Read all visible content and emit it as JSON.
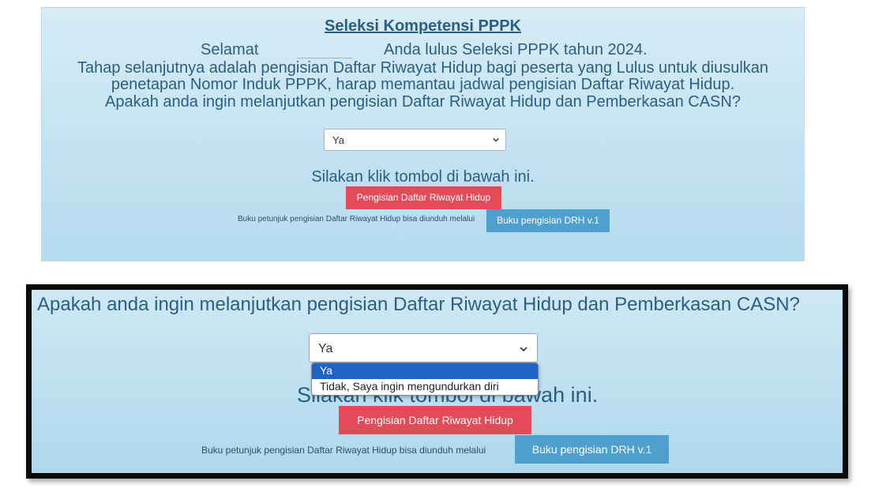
{
  "top": {
    "title": "Seleksi Kompetensi PPPK",
    "greeting": "Selamat",
    "passed_text": "Anda lulus Seleksi PPPK tahun 2024.",
    "line2": "Tahap selanjutnya adalah pengisian Daftar Riwayat Hidup bagi peserta yang Lulus untuk diusulkan",
    "line3": "penetapan Nomor Induk PPPK, harap memantau jadwal pengisian Daftar Riwayat Hidup.",
    "question": "Apakah anda ingin melanjutkan pengisian Daftar Riwayat Hidup dan Pemberkasan CASN?",
    "select_value": "Ya",
    "instruction": "Silakan klik tombol di bawah ini.",
    "drh_button": "Pengisian Daftar Riwayat Hidup",
    "guide_text": "Buku petunjuk pengisian Daftar Riwayat Hidup bisa diunduh melalui",
    "guide_button": "Buku pengisian DRH v.1"
  },
  "zoom": {
    "question": "Apakah anda ingin melanjutkan pengisian Daftar Riwayat Hidup dan Pemberkasan CASN?",
    "select_value": "Ya",
    "options": [
      "Ya",
      "Tidak, Saya ingin mengundurkan diri"
    ],
    "instruction": "Silakan klik tombol di bawah ini.",
    "drh_button": "Pengisian Daftar Riwayat Hidup",
    "guide_text": "Buku petunjuk pengisian Daftar Riwayat Hidup bisa diunduh melalui",
    "guide_button": "Buku pengisian DRH v.1"
  }
}
